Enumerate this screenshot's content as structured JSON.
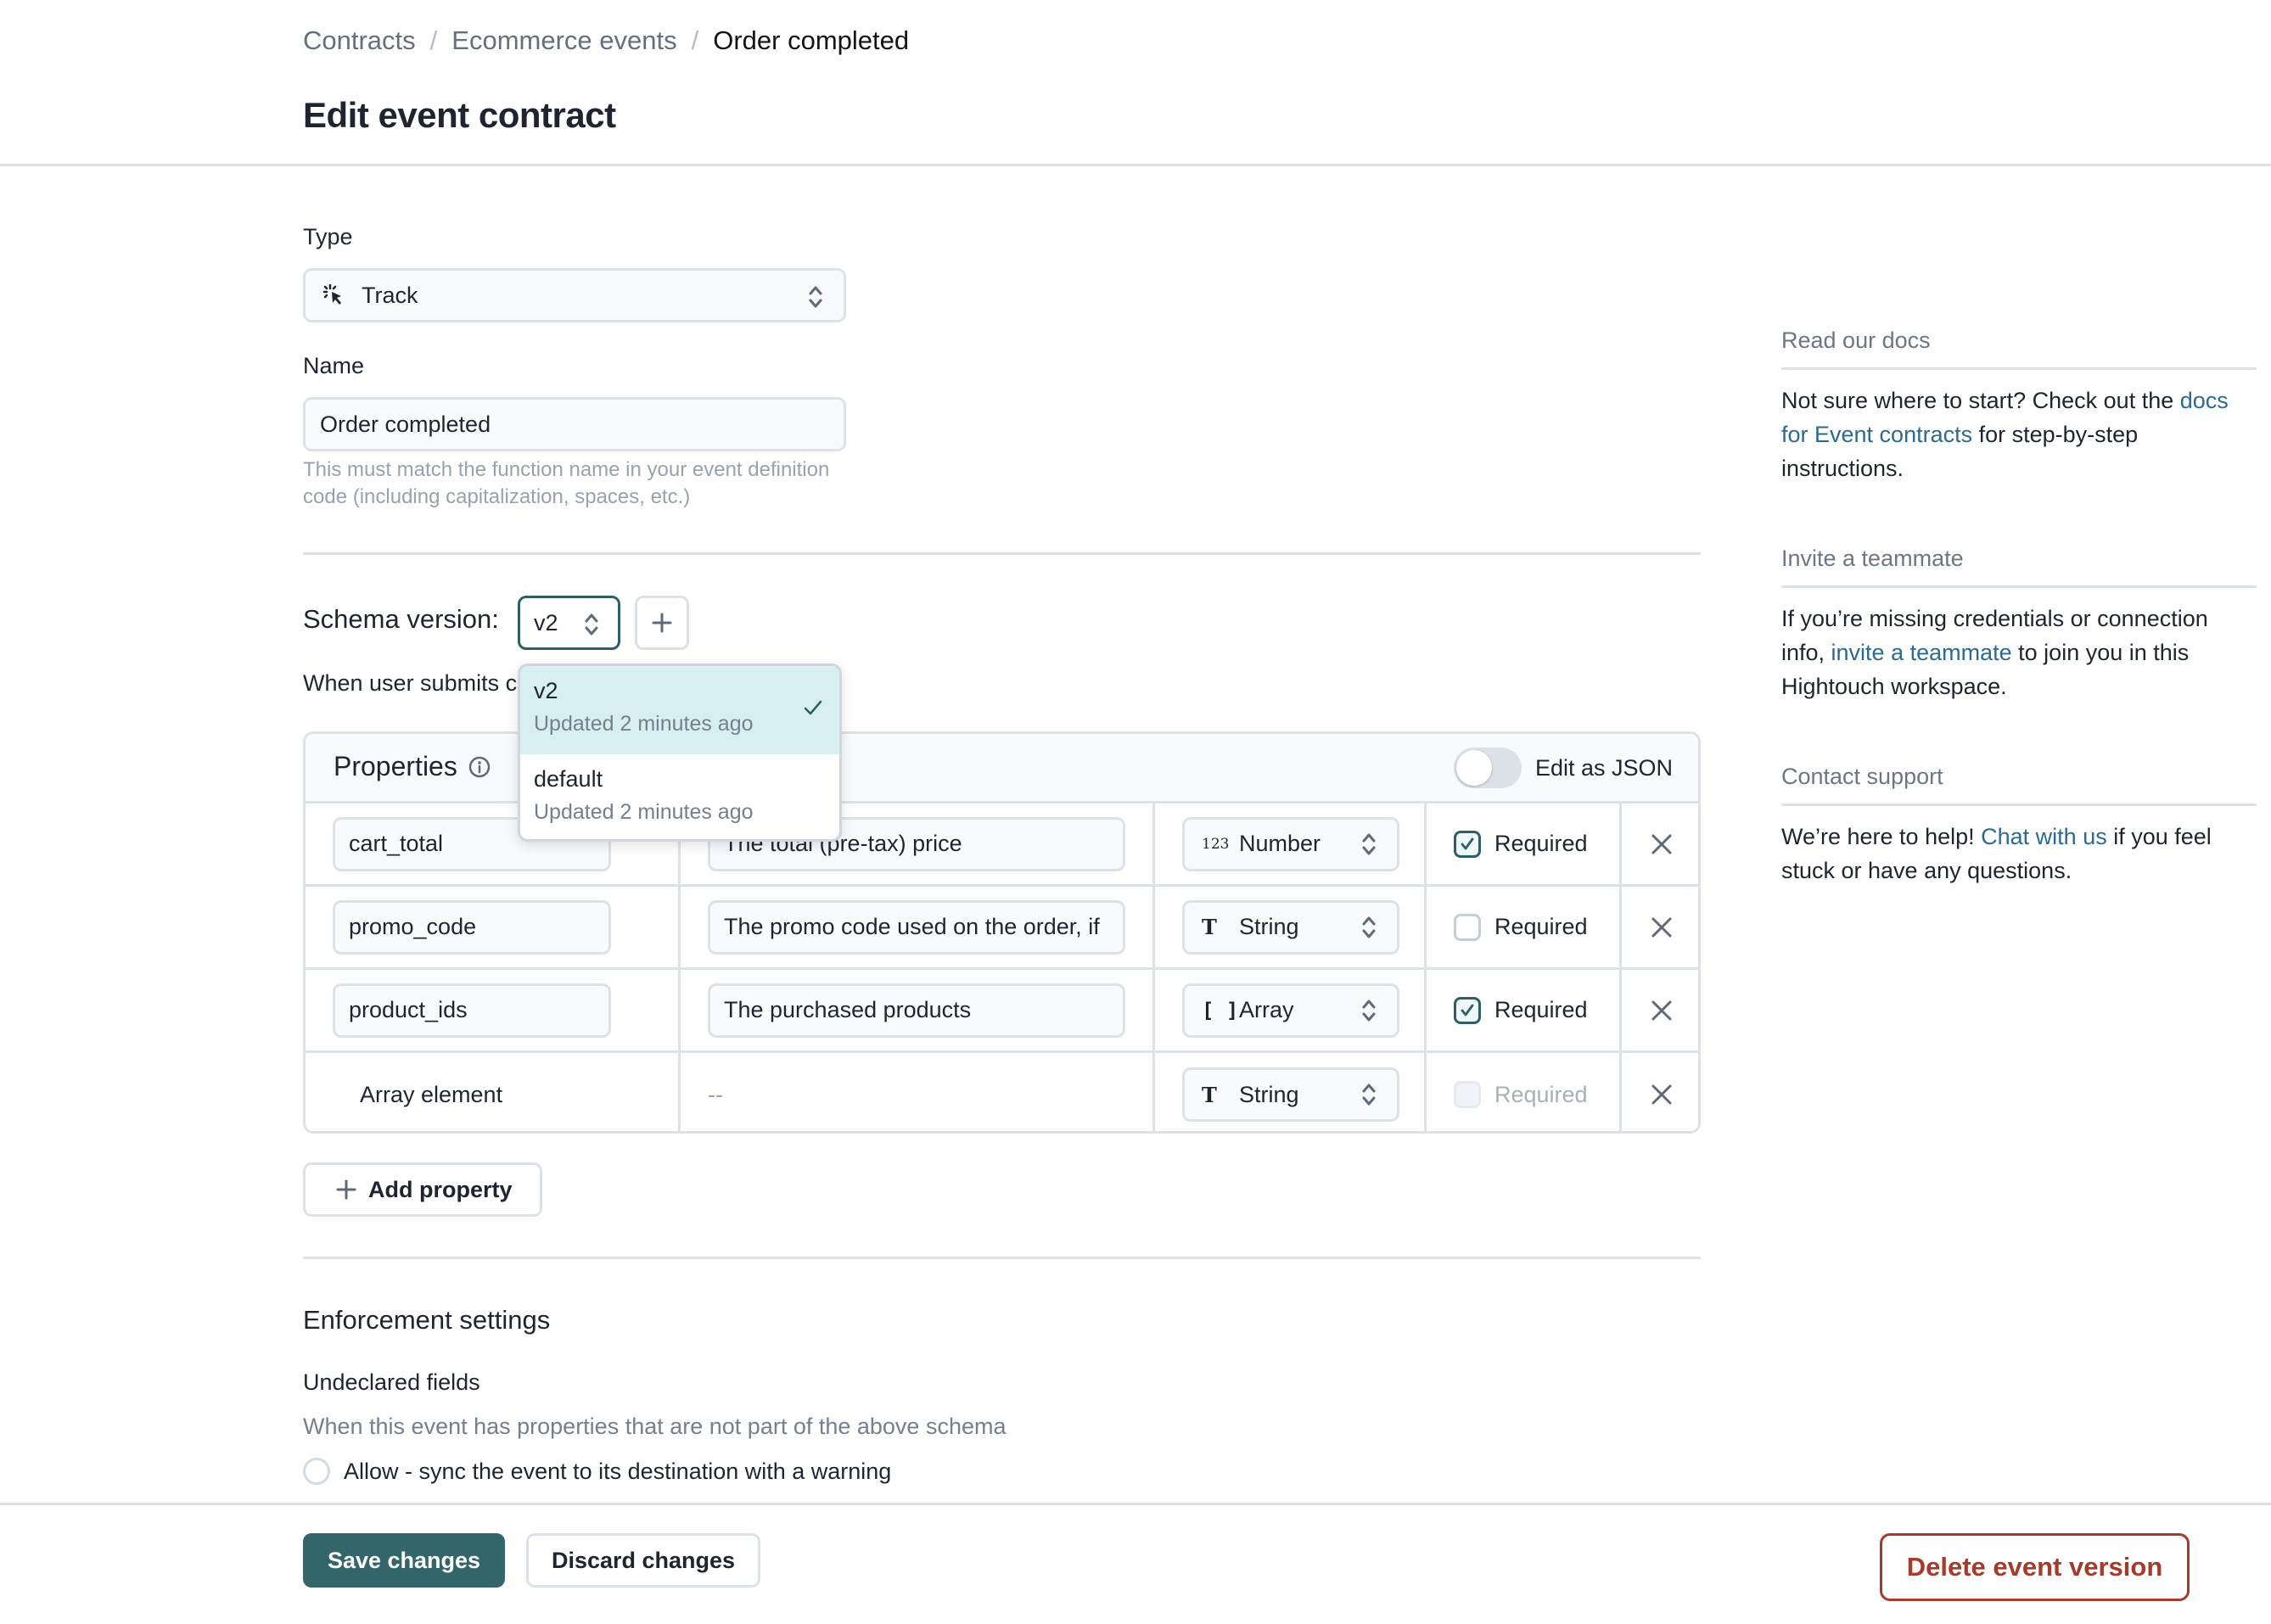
{
  "header": {
    "breadcrumbs": [
      "Contracts",
      "Ecommerce events",
      "Order completed"
    ],
    "separator": "/",
    "title": "Edit event contract"
  },
  "form": {
    "type_label": "Type",
    "type_value": "Track",
    "type_icon": "cursor-click-icon",
    "name_label": "Name",
    "name_value": "Order completed",
    "name_hint": "This must match the function name in your event definition code (including capitalization, spaces, etc.)"
  },
  "schema": {
    "label": "Schema version:",
    "selected": "v2",
    "add_icon": "plus-icon",
    "when_text": "When user submits c",
    "menu": [
      {
        "title": "v2",
        "subtitle": "Updated 2 minutes ago",
        "selected": true
      },
      {
        "title": "default",
        "subtitle": "Updated 2 minutes ago",
        "selected": false
      }
    ]
  },
  "properties": {
    "title": "Properties",
    "edit_json_label": "Edit as JSON",
    "edit_json_on": false,
    "rows": [
      {
        "name": "cart_total",
        "description": "The total (pre-tax) price",
        "type": "Number",
        "type_icon": "123",
        "required": true,
        "required_disabled": false,
        "nested": false
      },
      {
        "name": "promo_code",
        "description": "The promo code used on the order, if",
        "type": "String",
        "type_icon": "T",
        "required": false,
        "required_disabled": false,
        "nested": false
      },
      {
        "name": "product_ids",
        "description": "The purchased products",
        "type": "Array",
        "type_icon": "[ ]",
        "required": true,
        "required_disabled": false,
        "nested": false
      },
      {
        "name": "Array element",
        "description": "--",
        "type": "String",
        "type_icon": "T",
        "required": false,
        "required_disabled": true,
        "nested": true
      }
    ],
    "required_label": "Required",
    "add_label": "Add property"
  },
  "enforcement": {
    "title": "Enforcement settings",
    "undeclared_title": "Undeclared fields",
    "undeclared_desc": "When this event has properties that are not part of the above schema",
    "options": [
      {
        "label": "Allow - sync the event to its destination with a warning",
        "selected": false
      }
    ]
  },
  "footer": {
    "save_label": "Save changes",
    "discard_label": "Discard changes",
    "delete_label": "Delete event version"
  },
  "sidebar": {
    "docs": {
      "title": "Read our docs",
      "before": "Not sure where to start? Check out the ",
      "link": "docs for Event contracts",
      "after": " for step-by-step instructions."
    },
    "invite": {
      "title": "Invite a teammate",
      "before": "If you’re missing credentials or connection info, ",
      "link": "invite a teammate",
      "after": " to join you in this Hightouch workspace."
    },
    "support": {
      "title": "Contact support",
      "before": "We’re here to help! ",
      "link": "Chat with us",
      "after": " if you feel stuck or have any questions."
    }
  },
  "colors": {
    "primary": "#33666a",
    "danger": "#a63a2b",
    "link": "#2a6a93",
    "menu_selected": "#d8eff1",
    "border": "#dde2e8"
  }
}
